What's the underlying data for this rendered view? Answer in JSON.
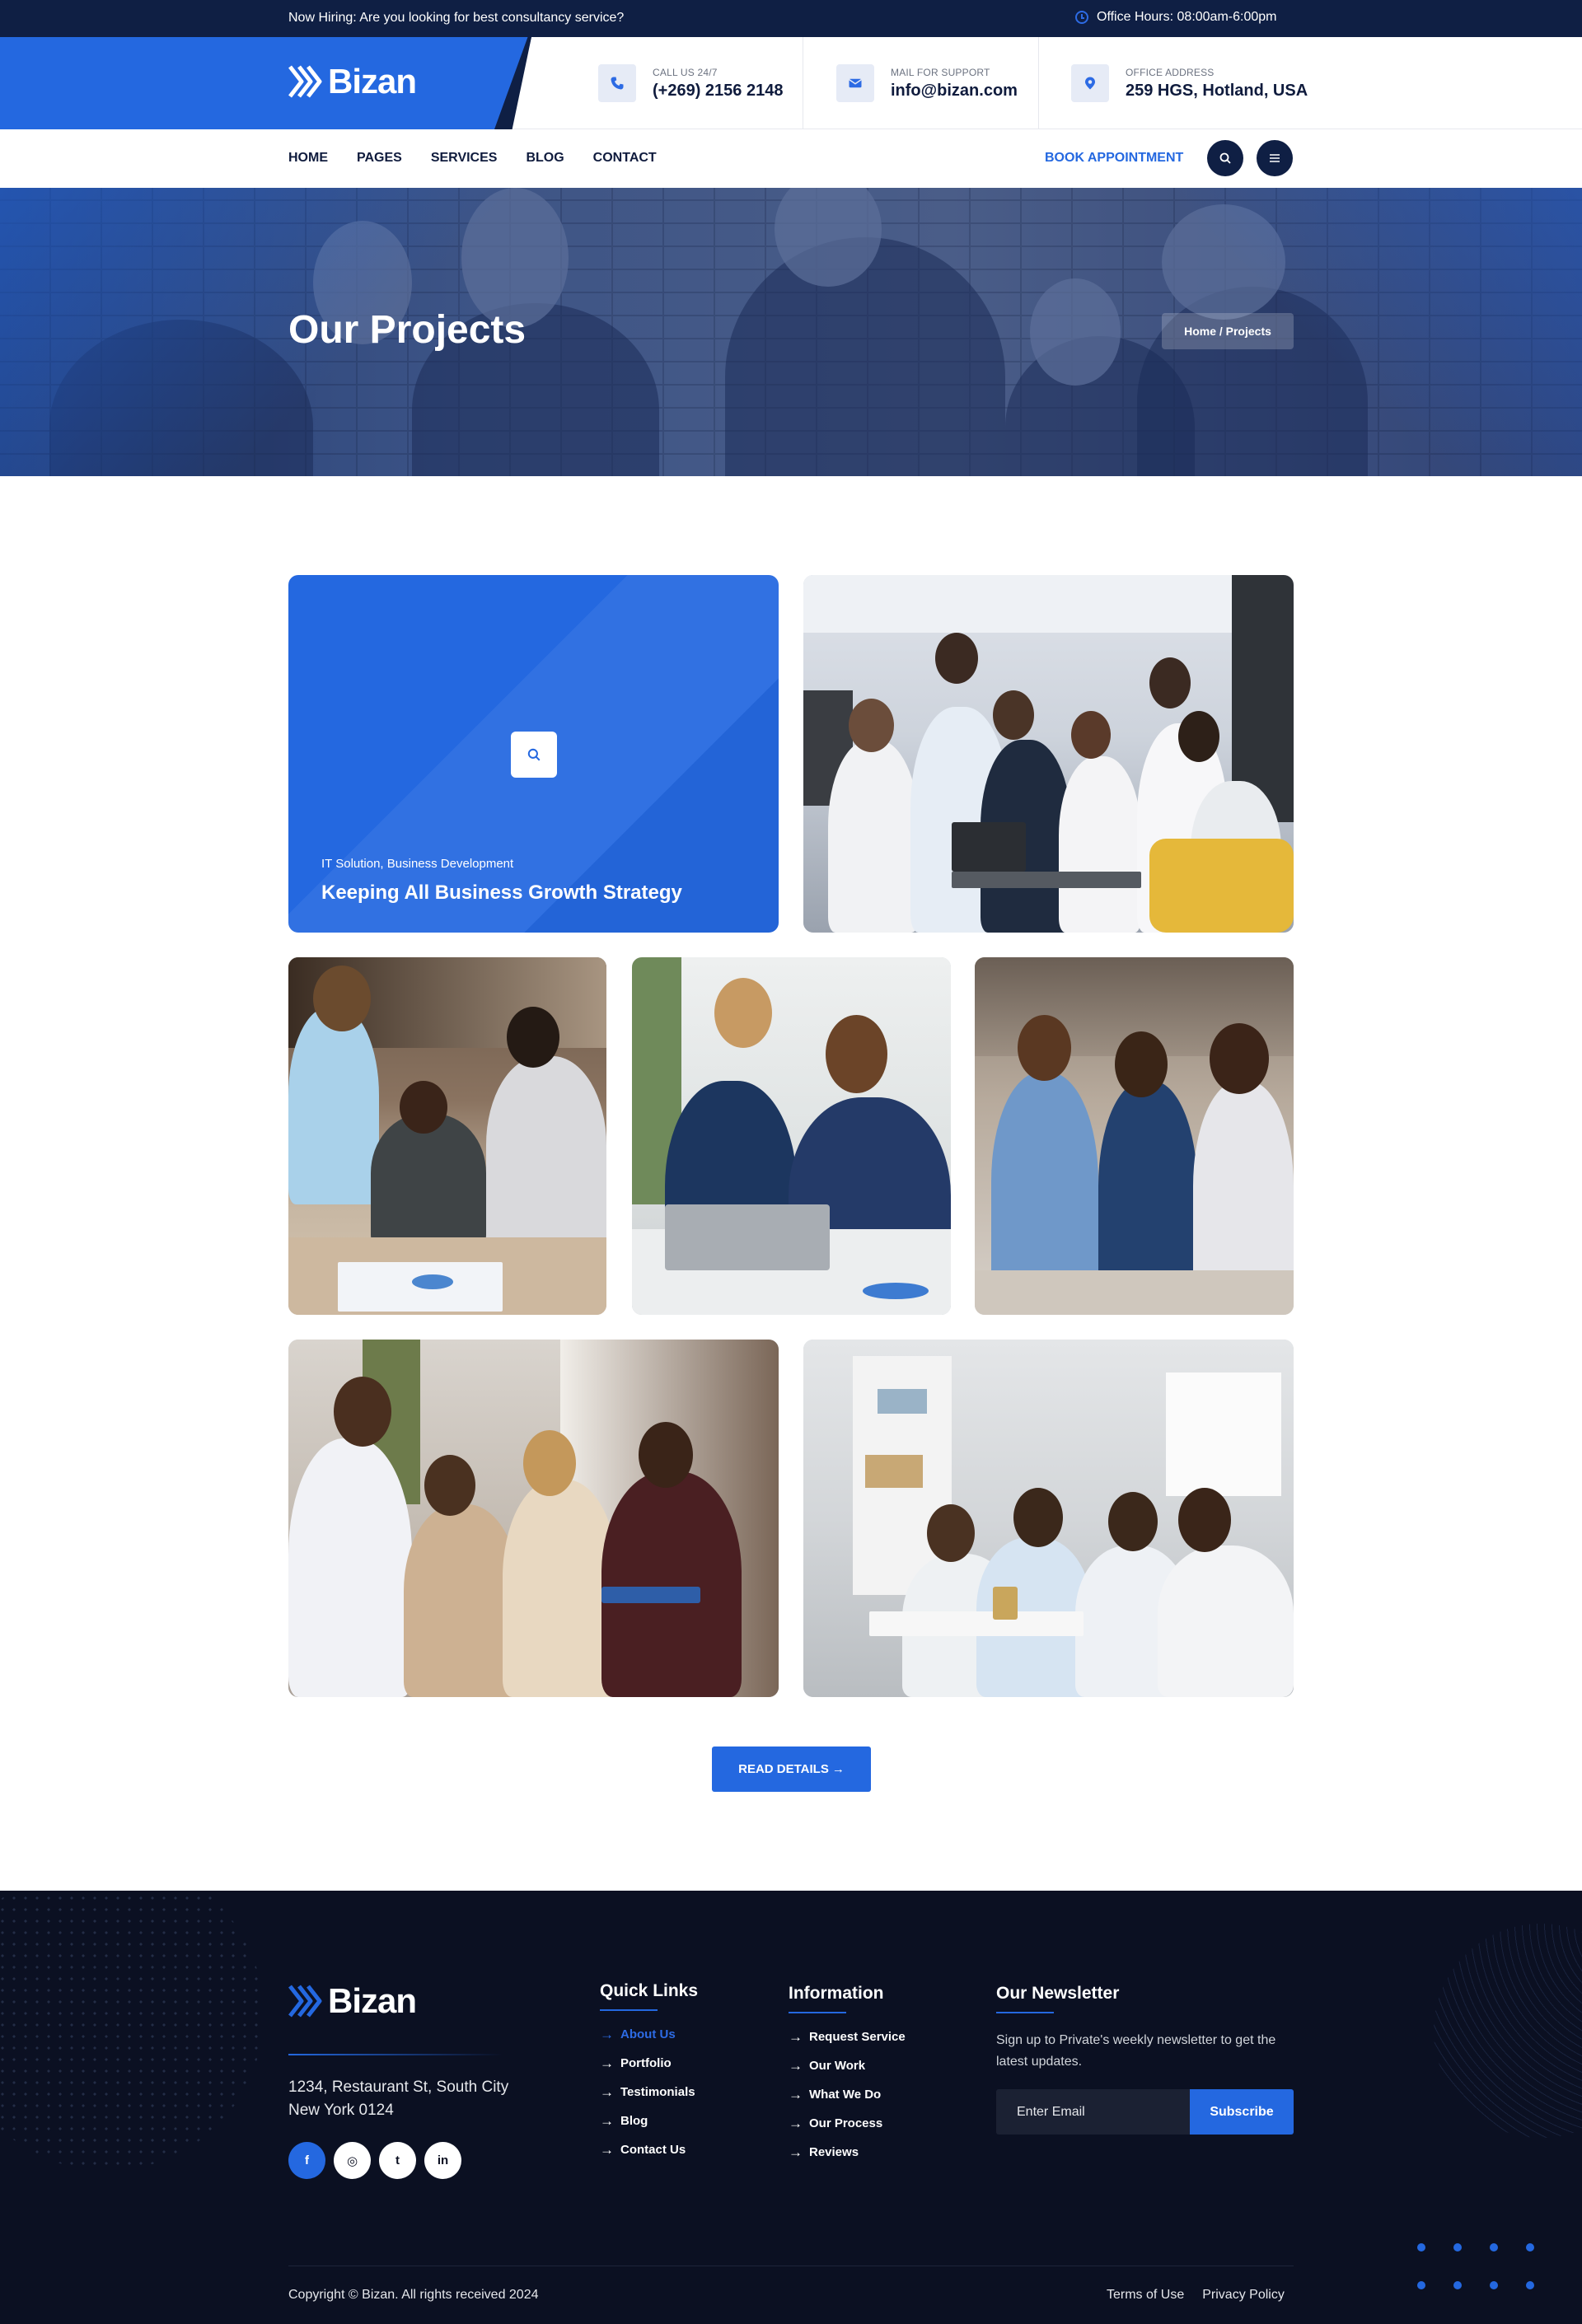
{
  "topbar": {
    "hiring_text": "Now Hiring: Are you looking for best consultancy service?",
    "office_hours": "Office Hours: 08:00am-6:00pm",
    "icon": "clock-icon"
  },
  "brand": {
    "name": "Bizan",
    "icon": "chevron-logo-icon"
  },
  "header": {
    "call": {
      "label": "CALL US 24/7",
      "value": "(+269) 2156 2148",
      "icon": "phone-icon"
    },
    "mail": {
      "label": "MAIL FOR SUPPORT",
      "value": "info@bizan.com",
      "icon": "envelope-icon"
    },
    "address": {
      "label": "OFFICE ADDRESS",
      "value": "259 HGS, Hotland, USA",
      "icon": "location-pin-icon"
    }
  },
  "nav": {
    "items": [
      "HOME",
      "PAGES",
      "SERVICES",
      "BLOG",
      "CONTACT"
    ],
    "book_label": "BOOK APPOINTMENT",
    "search_icon": "search-icon",
    "menu_icon": "hamburger-menu-icon"
  },
  "hero": {
    "title": "Our Projects",
    "breadcrumb": "Home / Projects"
  },
  "projects": {
    "featured": {
      "category": "IT Solution, Business Development",
      "title": "Keeping All Business Growth Strategy",
      "icon": "search-icon"
    },
    "read_button": "READ DETAILS",
    "read_icon": "arrow-right-icon"
  },
  "footer": {
    "address_line1": "1234, Restaurant St, South City",
    "address_line2": "New York 0124",
    "socials": [
      {
        "icon": "facebook-icon",
        "glyph": "f"
      },
      {
        "icon": "instagram-icon",
        "glyph": "◎"
      },
      {
        "icon": "twitter-icon",
        "glyph": "t"
      },
      {
        "icon": "linkedin-icon",
        "glyph": "in"
      }
    ],
    "quick_links": {
      "title": "Quick Links",
      "items": [
        "About Us",
        "Portfolio",
        "Testimonials",
        "Blog",
        "Contact Us"
      ]
    },
    "information": {
      "title": "Information",
      "items": [
        "Request Service",
        "Our Work",
        "What We Do",
        "Our Process",
        "Reviews"
      ]
    },
    "newsletter": {
      "title": "Our Newsletter",
      "text": "Sign up to Private's weekly newsletter to get the latest updates.",
      "placeholder": "Enter Email",
      "button": "Subscribe"
    },
    "copyright": "Copyright © Bizan. All rights received 2024",
    "terms": "Terms of Use",
    "privacy": "Privacy Policy"
  },
  "colors": {
    "accent": "#2468e0",
    "navy": "#0f1f44",
    "footer_bg": "#0b1022"
  }
}
